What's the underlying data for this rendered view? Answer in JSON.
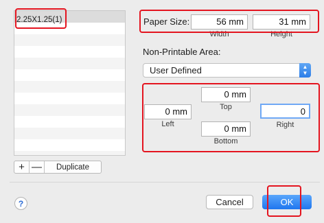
{
  "list": {
    "items": [
      "2.25X1.25(1)"
    ],
    "add_label": "+",
    "remove_label": "—",
    "duplicate_label": "Duplicate"
  },
  "paper_size": {
    "label": "Paper Size:",
    "width_value": "56 mm",
    "width_label": "Width",
    "height_value": "31 mm",
    "height_label": "Height"
  },
  "non_printable": {
    "label": "Non-Printable Area:",
    "mode": "User Defined",
    "top_value": "0 mm",
    "top_label": "Top",
    "left_value": "0 mm",
    "left_label": "Left",
    "bottom_value": "0 mm",
    "bottom_label": "Bottom",
    "right_value": "0",
    "right_label": "Right"
  },
  "buttons": {
    "help": "?",
    "cancel": "Cancel",
    "ok": "OK"
  },
  "colors": {
    "annotation": "#e4141f",
    "accent": "#2d7ee8"
  }
}
